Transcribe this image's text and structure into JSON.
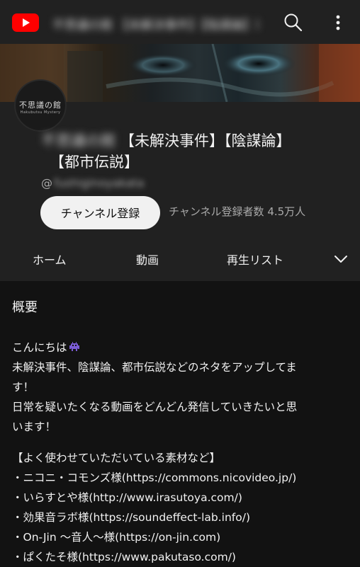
{
  "topbar": {
    "logo_icon": "youtube-logo-icon",
    "title_blurred": "不思議の館 【未解決事件】【陰謀論】【都市伝説】",
    "search_icon": "search-icon",
    "more_icon": "more-vertical-icon"
  },
  "banner": {
    "image": "channel-banner"
  },
  "channel": {
    "avatar_text": "不思議の館",
    "avatar_sub": "Hakubutsu Mystery",
    "name_blurred": "不思議の館",
    "name_line1": "【未解決事件】【陰謀論】",
    "name_line2": "【都市伝説】",
    "handle_prefix": "@",
    "handle_blurred": "fushiginoyakata",
    "subscribe_label": "チャンネル登録",
    "subscriber_count": "チャンネル登録者数 4.5万人"
  },
  "tabs": {
    "home": "ホーム",
    "videos": "動画",
    "playlists": "再生リスト",
    "more_icon": "chevron-down-icon"
  },
  "about": {
    "title": "概要",
    "lines": [
      "こんにちは",
      "未解決事件、陰謀論、都市伝説などのネタをアップしてま",
      "す！",
      "日常を疑いたくなる動画をどんどん発信していきたいと思",
      "います！",
      "【よく使わせていただいている素材など】",
      "・ニコニ・コモンズ様(https://commons.nicovideo.jp/)",
      "・いらすとや様(http://www.irasutoya.com/)",
      "・効果音ラボ様(https://soundeffect-lab.info/)",
      "・On-Jin 〜音人〜様(https://on-jin.com)",
      "・ぱくたそ様(https://www.pakutaso.com/)"
    ],
    "emoji_icon": "alien-monster-icon"
  },
  "colors": {
    "background": "#0f0f0f",
    "header": "#212121",
    "youtube_red": "#ff0000",
    "subscribe_bg": "#f1f1f1",
    "secondary_text": "#aaaaaa"
  }
}
